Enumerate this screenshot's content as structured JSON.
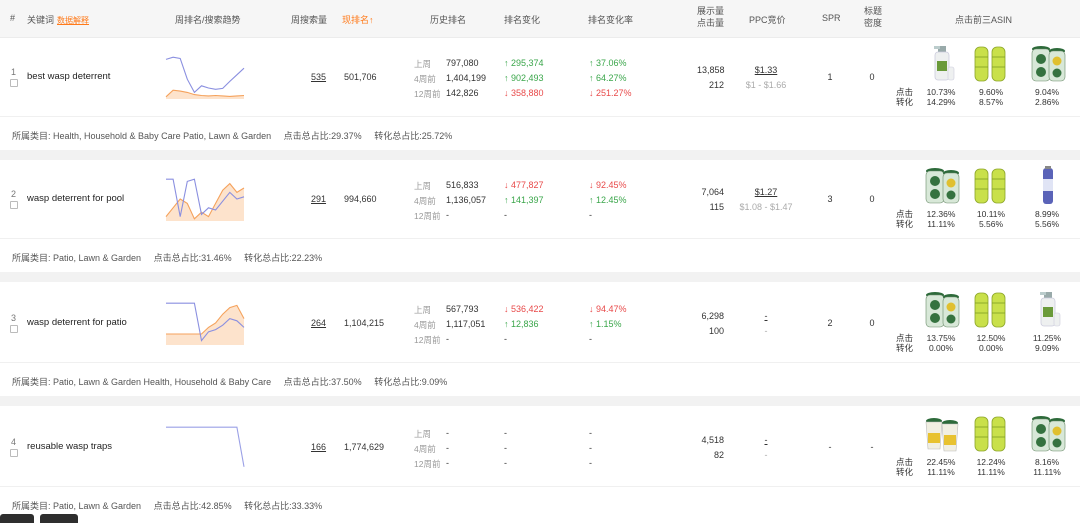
{
  "header": {
    "col_index": "#",
    "col_keyword": "关键词",
    "col_keyword_link": "数据解释",
    "col_trend": "周排名/搜索趋势",
    "col_weekly_search": "周搜索量",
    "col_current_rank": "现排名↑",
    "col_history_rank": "历史排名",
    "col_rank_change": "排名变化",
    "col_rank_change_rate": "排名变化率",
    "col_impressions_line1": "展示量",
    "col_impressions_line2": "点击量",
    "col_ppc": "PPC竞价",
    "col_spr": "SPR",
    "col_title_density_line1": "标题",
    "col_title_density_line2": "密度",
    "col_top3": "点击前三ASIN"
  },
  "labels": {
    "last_week": "上周",
    "four_weeks": "4周前",
    "twelve_weeks": "12周前",
    "click": "点击",
    "conversion": "转化"
  },
  "rows": [
    {
      "index": "1",
      "keyword": "best wasp deterrent",
      "weekly_search": "535",
      "current_rank": "501,706",
      "history": [
        "797,080",
        "1,404,199",
        "142,826"
      ],
      "change": [
        {
          "v": "↑ 295,374",
          "dir": "up"
        },
        {
          "v": "↑ 902,493",
          "dir": "up"
        },
        {
          "v": "↓ 358,880",
          "dir": "down"
        }
      ],
      "rate": [
        {
          "v": "↑ 37.06%",
          "dir": "up"
        },
        {
          "v": "↑ 64.27%",
          "dir": "up"
        },
        {
          "v": "↓ 251.27%",
          "dir": "down"
        }
      ],
      "impressions": "13,858",
      "clicks": "212",
      "ppc": "$1.33",
      "ppc_range": "$1 - $1.66",
      "spr": "1",
      "density": "0",
      "asins": [
        {
          "click": "10.73%",
          "conv": "14.29%",
          "img": "spray"
        },
        {
          "click": "9.60%",
          "conv": "8.57%",
          "img": "yellow"
        },
        {
          "click": "9.04%",
          "conv": "2.86%",
          "img": "jar"
        }
      ],
      "foot_category": "所属类目: Health, Household & Baby Care Patio, Lawn & Garden",
      "foot_click": "点击总占比:29.37%",
      "foot_conv": "转化总占比:25.72%",
      "trend_rank": [
        0.1,
        0.05,
        0.08,
        0.55,
        0.85,
        0.7,
        0.75,
        0.78,
        0.76,
        0.6,
        0.45,
        0.3
      ],
      "trend_search": [
        0.95,
        0.8,
        0.82,
        0.85,
        0.9,
        0.92,
        0.93,
        0.92,
        0.93,
        0.94,
        0.93,
        0.92
      ]
    },
    {
      "index": "2",
      "keyword": "wasp deterrent for pool",
      "weekly_search": "291",
      "current_rank": "994,660",
      "history": [
        "516,833",
        "1,136,057",
        "-"
      ],
      "change": [
        {
          "v": "↓ 477,827",
          "dir": "down"
        },
        {
          "v": "↑ 141,397",
          "dir": "up"
        },
        {
          "v": "-",
          "dir": "none"
        }
      ],
      "rate": [
        {
          "v": "↓ 92.45%",
          "dir": "down"
        },
        {
          "v": "↑ 12.45%",
          "dir": "up"
        },
        {
          "v": "-",
          "dir": "none"
        }
      ],
      "impressions": "7,064",
      "clicks": "115",
      "ppc": "$1.27",
      "ppc_range": "$1.08 - $1.47",
      "spr": "3",
      "density": "0",
      "asins": [
        {
          "click": "12.36%",
          "conv": "11.11%",
          "img": "jar"
        },
        {
          "click": "10.11%",
          "conv": "5.56%",
          "img": "yellow"
        },
        {
          "click": "8.99%",
          "conv": "5.56%",
          "img": "can"
        }
      ],
      "foot_category": "所属类目: Patio, Lawn & Garden",
      "foot_click": "点击总占比:31.46%",
      "foot_conv": "转化总占比:22.23%",
      "trend_rank": [
        0.05,
        0.05,
        0.9,
        0.1,
        0.05,
        0.85,
        0.7,
        0.75,
        0.55,
        0.35,
        0.5,
        0.45
      ],
      "trend_search": [
        0.9,
        0.7,
        0.5,
        0.6,
        0.95,
        0.8,
        0.9,
        0.6,
        0.3,
        0.15,
        0.35,
        0.25
      ]
    },
    {
      "index": "3",
      "keyword": "wasp deterrent for patio",
      "weekly_search": "264",
      "current_rank": "1,104,215",
      "history": [
        "567,793",
        "1,117,051",
        "-"
      ],
      "change": [
        {
          "v": "↓ 536,422",
          "dir": "down"
        },
        {
          "v": "↑ 12,836",
          "dir": "up"
        },
        {
          "v": "-",
          "dir": "none"
        }
      ],
      "rate": [
        {
          "v": "↓ 94.47%",
          "dir": "down"
        },
        {
          "v": "↑ 1.15%",
          "dir": "up"
        },
        {
          "v": "-",
          "dir": "none"
        }
      ],
      "impressions": "6,298",
      "clicks": "100",
      "ppc": "-",
      "ppc_range": "-",
      "spr": "2",
      "density": "0",
      "asins": [
        {
          "click": "13.75%",
          "conv": "0.00%",
          "img": "jar"
        },
        {
          "click": "12.50%",
          "conv": "0.00%",
          "img": "yellow"
        },
        {
          "click": "11.25%",
          "conv": "9.09%",
          "img": "spray"
        }
      ],
      "foot_category": "所属类目: Patio, Lawn & Garden Health, Household & Baby Care",
      "foot_click": "点击总占比:37.50%",
      "foot_conv": "转化总占比:9.09%",
      "trend_rank": [
        0.05,
        0.05,
        0.05,
        0.05,
        0.05,
        0.9,
        0.7,
        0.65,
        0.55,
        0.4,
        0.45,
        0.6
      ],
      "trend_search": [
        0.75,
        0.75,
        0.75,
        0.75,
        0.75,
        0.75,
        0.6,
        0.5,
        0.3,
        0.15,
        0.1,
        0.4
      ]
    },
    {
      "index": "4",
      "keyword": "reusable wasp traps",
      "weekly_search": "166",
      "current_rank": "1,774,629",
      "history": [
        "-",
        "-",
        "-"
      ],
      "change": [
        {
          "v": "-",
          "dir": "none"
        },
        {
          "v": "-",
          "dir": "none"
        },
        {
          "v": "-",
          "dir": "none"
        }
      ],
      "rate": [
        {
          "v": "-",
          "dir": "none"
        },
        {
          "v": "-",
          "dir": "none"
        },
        {
          "v": "-",
          "dir": "none"
        }
      ],
      "impressions": "4,518",
      "clicks": "82",
      "ppc": "-",
      "ppc_range": "-",
      "spr": "-",
      "density": "-",
      "asins": [
        {
          "click": "22.45%",
          "conv": "11.11%",
          "img": "yellowjar"
        },
        {
          "click": "12.24%",
          "conv": "11.11%",
          "img": "yellow"
        },
        {
          "click": "8.16%",
          "conv": "11.11%",
          "img": "jar"
        }
      ],
      "foot_category": "所属类目: Patio, Lawn & Garden",
      "foot_click": "点击总占比:42.85%",
      "foot_conv": "转化总占比:33.33%",
      "trend_rank": [
        0.05,
        0.05,
        0.05,
        0.05,
        0.05,
        0.05,
        0.05,
        0.05,
        0.05,
        0.05,
        0.05,
        0.95
      ],
      "trend_search": []
    }
  ],
  "colors": {
    "accent": "#ff7a1a",
    "up": "#3aa64a",
    "down": "#e84a4a",
    "rank_line": "#8a8fe0",
    "search_line": "#f5a25c",
    "search_fill": "#fde3cc"
  }
}
